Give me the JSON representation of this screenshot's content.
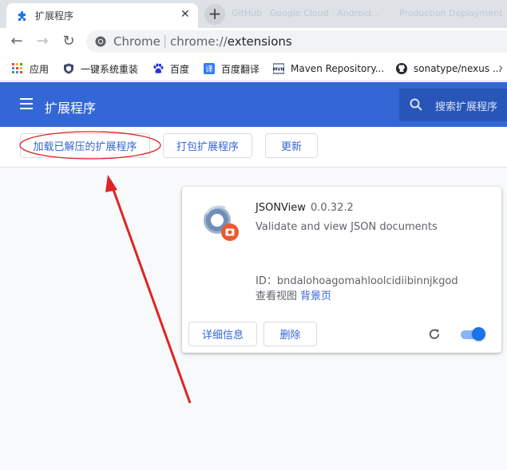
{
  "tab": {
    "title": "扩展程序",
    "close": "✕",
    "new_tab": "+"
  },
  "ghost_tabs": [
    "GitHub",
    "Google Cloud · Android...",
    "Production Deployment"
  ],
  "toolbar": {
    "back": "←",
    "forward": "→",
    "reload": "↻",
    "scheme": "Chrome",
    "separator": "|",
    "url_prefix": "chrome://",
    "url_path": "extensions"
  },
  "bookmarks": [
    {
      "label": "应用",
      "icon": "apps-grid-icon"
    },
    {
      "label": "一键系统重装",
      "icon": "shield-icon"
    },
    {
      "label": "百度",
      "icon": "baidu-paw-icon"
    },
    {
      "label": "百度翻译",
      "icon": "translate-icon"
    },
    {
      "label": "Maven Repository...",
      "icon": "maven-icon"
    },
    {
      "label": "sonatype/nexus ...",
      "icon": "github-icon"
    }
  ],
  "header": {
    "title": "扩展程序",
    "search_placeholder": "搜索扩展程序"
  },
  "actions": {
    "load_unpacked": "加载已解压的扩展程序",
    "pack": "打包扩展程序",
    "update": "更新"
  },
  "extension": {
    "name": "JSONView",
    "version": "0.0.32.2",
    "description": "Validate and view JSON documents",
    "id_text": "ID：bndalohoagomahloolcidiibinnjkgod",
    "inspect_label": "查看视图",
    "inspect_link": "背景页",
    "details_button": "详细信息",
    "remove_button": "删除",
    "enabled": true
  },
  "colors": {
    "brand_blue": "#3367d6",
    "annotation_red": "#e02424"
  }
}
